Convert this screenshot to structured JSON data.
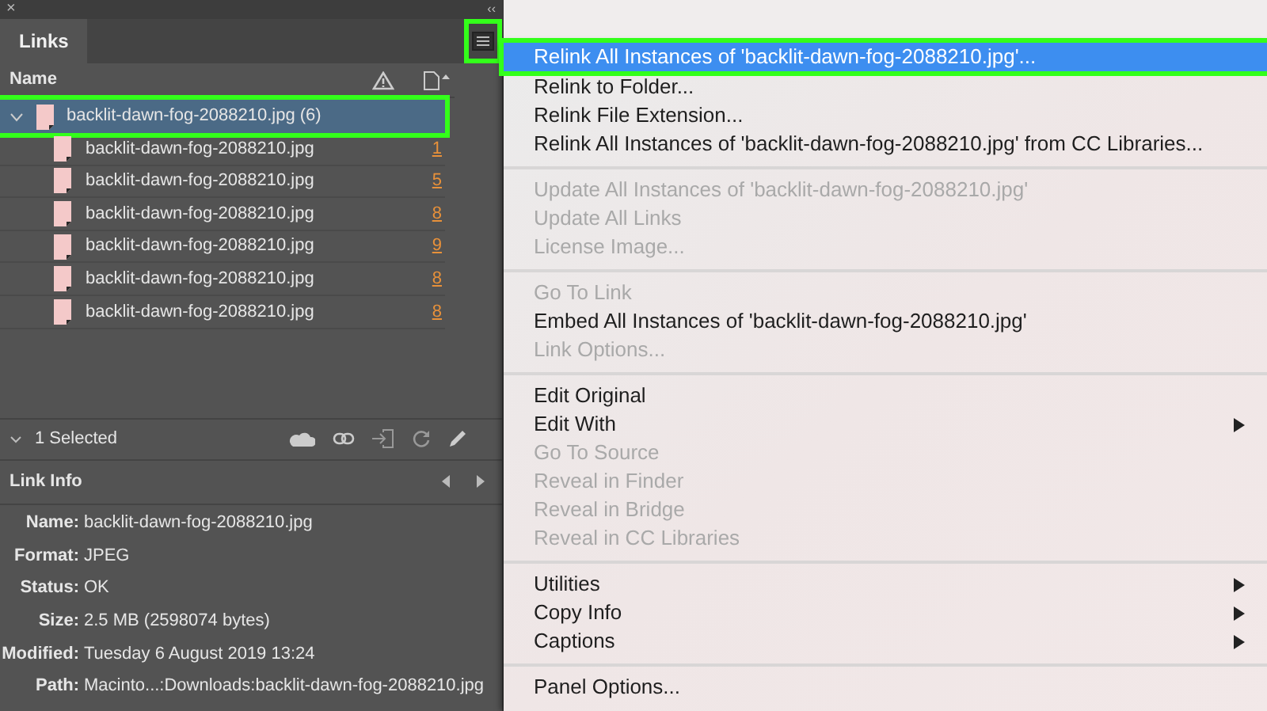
{
  "panel": {
    "close": "×",
    "collapse": "‹‹",
    "tabs": [
      {
        "label": "Links",
        "selected": true
      }
    ],
    "columns": [
      {
        "label": "Name"
      }
    ],
    "parent": {
      "name": "backlit-dawn-fog-2088210.jpg (6)",
      "expanded": true,
      "selected": true,
      "highlighted": true
    },
    "children": [
      {
        "name": "backlit-dawn-fog-2088210.jpg",
        "page": "1"
      },
      {
        "name": "backlit-dawn-fog-2088210.jpg",
        "page": "5"
      },
      {
        "name": "backlit-dawn-fog-2088210.jpg",
        "page": "8"
      },
      {
        "name": "backlit-dawn-fog-2088210.jpg",
        "page": "9"
      },
      {
        "name": "backlit-dawn-fog-2088210.jpg",
        "page": "8"
      },
      {
        "name": "backlit-dawn-fog-2088210.jpg",
        "page": "8"
      }
    ],
    "selection": "1 Selected",
    "link_info": {
      "title": "Link Info",
      "rows": [
        {
          "label": "Name:",
          "value": "backlit-dawn-fog-2088210.jpg"
        },
        {
          "label": "Format:",
          "value": "JPEG"
        },
        {
          "label": "Status:",
          "value": "OK"
        },
        {
          "label": "Size:",
          "value": "2.5 MB (2598074 bytes)"
        },
        {
          "label": "Modified:",
          "value": "Tuesday 6 August 2019 13:24"
        },
        {
          "label": "Path:",
          "value": "Macinto...:Downloads:backlit-dawn-fog-2088210.jpg"
        }
      ]
    },
    "menu_button_highlighted": true
  },
  "menu": [
    {
      "kind": "item",
      "label": "Relink All Instances of 'backlit-dawn-fog-2088210.jpg'...",
      "disabled": false,
      "submenu": false,
      "selected": true
    },
    {
      "kind": "item",
      "label": "Relink to Folder...",
      "disabled": false,
      "submenu": false,
      "selected": false
    },
    {
      "kind": "item",
      "label": "Relink File Extension...",
      "disabled": false,
      "submenu": false,
      "selected": false
    },
    {
      "kind": "item",
      "label": "Relink All Instances of 'backlit-dawn-fog-2088210.jpg' from CC Libraries...",
      "disabled": false,
      "submenu": false,
      "selected": false
    },
    {
      "kind": "separator"
    },
    {
      "kind": "item",
      "label": "Update All Instances of 'backlit-dawn-fog-2088210.jpg'",
      "disabled": true,
      "submenu": false,
      "selected": false
    },
    {
      "kind": "item",
      "label": "Update All Links",
      "disabled": true,
      "submenu": false,
      "selected": false
    },
    {
      "kind": "item",
      "label": "License Image...",
      "disabled": true,
      "submenu": false,
      "selected": false
    },
    {
      "kind": "separator"
    },
    {
      "kind": "item",
      "label": "Go To Link",
      "disabled": true,
      "submenu": false,
      "selected": false
    },
    {
      "kind": "item",
      "label": "Embed All Instances of 'backlit-dawn-fog-2088210.jpg'",
      "disabled": false,
      "submenu": false,
      "selected": false
    },
    {
      "kind": "item",
      "label": "Link Options...",
      "disabled": true,
      "submenu": false,
      "selected": false
    },
    {
      "kind": "separator"
    },
    {
      "kind": "item",
      "label": "Edit Original",
      "disabled": false,
      "submenu": false,
      "selected": false
    },
    {
      "kind": "item",
      "label": "Edit With",
      "disabled": false,
      "submenu": true,
      "selected": false
    },
    {
      "kind": "item",
      "label": "Go To Source",
      "disabled": true,
      "submenu": false,
      "selected": false
    },
    {
      "kind": "item",
      "label": "Reveal in Finder",
      "disabled": true,
      "submenu": false,
      "selected": false
    },
    {
      "kind": "item",
      "label": "Reveal in Bridge",
      "disabled": true,
      "submenu": false,
      "selected": false
    },
    {
      "kind": "item",
      "label": "Reveal in CC Libraries",
      "disabled": true,
      "submenu": false,
      "selected": false
    },
    {
      "kind": "separator"
    },
    {
      "kind": "item",
      "label": "Utilities",
      "disabled": false,
      "submenu": true,
      "selected": false
    },
    {
      "kind": "item",
      "label": "Copy Info",
      "disabled": false,
      "submenu": true,
      "selected": false
    },
    {
      "kind": "item",
      "label": "Captions",
      "disabled": false,
      "submenu": true,
      "selected": false
    },
    {
      "kind": "separator"
    },
    {
      "kind": "item",
      "label": "Panel Options...",
      "disabled": false,
      "submenu": false,
      "selected": false
    }
  ]
}
